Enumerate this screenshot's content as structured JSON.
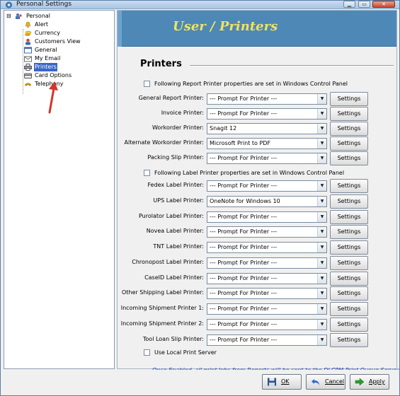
{
  "window": {
    "title": "Personal Settings",
    "controls": {
      "minimize": "▁",
      "maximize": "▭",
      "close": "✕"
    },
    "icon": "gear-people-icon"
  },
  "tree": {
    "root": {
      "label": "Personal",
      "expander": "⊟"
    },
    "items": [
      {
        "label": "Alert",
        "icon": "bell-icon"
      },
      {
        "label": "Currency",
        "icon": "coins-icon"
      },
      {
        "label": "Customers View",
        "icon": "person-icon"
      },
      {
        "label": "General",
        "icon": "window-icon"
      },
      {
        "label": "My Email",
        "icon": "envelope-icon"
      },
      {
        "label": "Printers",
        "icon": "printer-icon",
        "selected": true
      },
      {
        "label": "Card Options",
        "icon": "card-icon"
      },
      {
        "label": "Telephony",
        "icon": "phone-icon"
      }
    ],
    "annotation": "red-arrow"
  },
  "banner": {
    "title": "User / Printers"
  },
  "printers": {
    "section_title": "Printers",
    "report_checkbox_label": "Following Report Printer properties are set in Windows Control Panel",
    "label_checkbox_label": "Following Label Printer properties are set in Windows Control Panel",
    "settings_label": "Settings",
    "report_rows": [
      {
        "label": "General Report Printer:",
        "value": "--- Prompt For Printer ---"
      },
      {
        "label": "Invoice Printer:",
        "value": "--- Prompt For Printer ---"
      },
      {
        "label": "Workorder Printer:",
        "value": "Snagit 12"
      },
      {
        "label": "Alternate Workorder Printer:",
        "value": "Microsoft Print to PDF"
      },
      {
        "label": "Packing Slip Printer:",
        "value": "--- Prompt For Printer ---"
      }
    ],
    "label_rows": [
      {
        "label": "Fedex Label Printer:",
        "value": "--- Prompt For Printer ---"
      },
      {
        "label": "UPS Label Printer:",
        "value": "OneNote for Windows 10"
      },
      {
        "label": "Purolator Label Printer:",
        "value": "--- Prompt For Printer ---"
      },
      {
        "label": "Novea Label Printer:",
        "value": "--- Prompt For Printer ---"
      },
      {
        "label": "TNT Label Printer:",
        "value": "--- Prompt For Printer ---"
      },
      {
        "label": "Chronopost Label Printer:",
        "value": "--- Prompt For Printer ---"
      },
      {
        "label": "CaseID Label Printer:",
        "value": "--- Prompt For Printer ---"
      },
      {
        "label": "Other Shipping Label Printer:",
        "value": "--- Prompt For Printer ---"
      },
      {
        "label": "Incoming Shipment Printer 1:",
        "value": "--- Prompt For Printer ---"
      },
      {
        "label": "Incoming Shipment Printer 2:",
        "value": "--- Prompt For Printer ---"
      },
      {
        "label": "Tool Loan Slip Printer:",
        "value": "--- Prompt For Printer ---"
      }
    ],
    "local_server_label": "Use Local Print Server",
    "note": "Once Enabled, all print Jobs from Reports will be sent to the DLCPM Print Queue Server"
  },
  "footer": {
    "ok": "OK",
    "cancel": "Cancel",
    "apply": "Apply"
  },
  "colors": {
    "banner": "#4d88b7",
    "banner_text": "#f2e35a",
    "selection": "#3a67c7",
    "note_text": "#1e3dc9",
    "arrow": "#d0362c"
  }
}
